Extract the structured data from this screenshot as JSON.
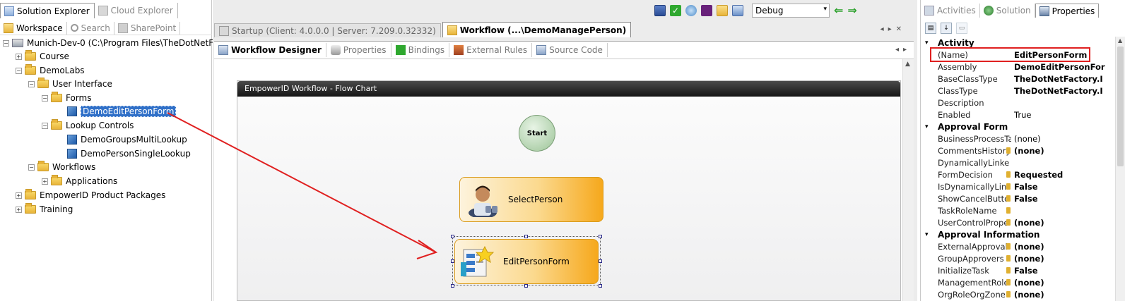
{
  "left_panel": {
    "tabs": [
      {
        "label": "Solution Explorer",
        "active": true
      },
      {
        "label": "Cloud Explorer",
        "active": false
      }
    ],
    "subtabs": [
      {
        "label": "Workspace"
      },
      {
        "label": "Search"
      },
      {
        "label": "SharePoint"
      }
    ],
    "tree": {
      "root": "Munich-Dev-0 (C:\\Program Files\\TheDotNetFacto",
      "course": "Course",
      "demolabs": "DemoLabs",
      "user_interface": "User Interface",
      "forms": "Forms",
      "demo_edit_person_form": "DemoEditPersonForm",
      "lookup_controls": "Lookup Controls",
      "demo_groups_multi_lookup": "DemoGroupsMultiLookup",
      "demo_person_single_lookup": "DemoPersonSingleLookup",
      "workflows": "Workflows",
      "applications": "Applications",
      "empowerid_product_packages": "EmpowerID Product Packages",
      "training": "Training"
    }
  },
  "toolbar": {
    "config_value": "Debug"
  },
  "document_tabs": [
    {
      "label": "Startup (Client: 4.0.0.0 | Server: 7.209.0.32332)",
      "active": false
    },
    {
      "label": "Workflow (...\\DemoManagePerson)",
      "active": true
    }
  ],
  "designer_tabs": [
    {
      "label": "Workflow Designer",
      "active": true
    },
    {
      "label": "Properties",
      "active": false
    },
    {
      "label": "Bindings",
      "active": false
    },
    {
      "label": "External Rules",
      "active": false
    },
    {
      "label": "Source Code",
      "active": false
    }
  ],
  "flowchart": {
    "title": "EmpowerID Workflow - Flow Chart",
    "start_label": "Start",
    "activities": [
      {
        "label": "SelectPerson"
      },
      {
        "label": "EditPersonForm"
      }
    ]
  },
  "right_panel": {
    "tabs": [
      {
        "label": "Activities",
        "active": false
      },
      {
        "label": "Solution",
        "active": false
      },
      {
        "label": "Properties",
        "active": true
      }
    ],
    "categories": {
      "activity": "Activity",
      "approval_form": "Approval Form",
      "approval_information": "Approval Information"
    },
    "properties": {
      "name": {
        "name": "(Name)",
        "value": "EditPersonForm"
      },
      "assembly": {
        "name": "Assembly",
        "value": "DemoEditPersonFor"
      },
      "base_class_type": {
        "name": "BaseClassType",
        "value": "TheDotNetFactory.I"
      },
      "class_type": {
        "name": "ClassType",
        "value": "TheDotNetFactory.I"
      },
      "description": {
        "name": "Description",
        "value": ""
      },
      "enabled": {
        "name": "Enabled",
        "value": "True"
      },
      "business_process": {
        "name": "BusinessProcessTa",
        "value": "(none)"
      },
      "comments_history": {
        "name": "CommentsHistory",
        "value": "(none)"
      },
      "dynamically_linked": {
        "name": "DynamicallyLinke",
        "value": ""
      },
      "form_decision": {
        "name": "FormDecision",
        "value": "Requested"
      },
      "is_dynamically_linked": {
        "name": "IsDynamicallyLin",
        "value": "False"
      },
      "show_cancel_button": {
        "name": "ShowCancelButto",
        "value": "False"
      },
      "task_role_name": {
        "name": "TaskRoleName",
        "value": ""
      },
      "user_control_properties": {
        "name": "UserControlPrope",
        "value": "(none)"
      },
      "external_approval": {
        "name": "ExternalApproval",
        "value": "(none)"
      },
      "group_approvers": {
        "name": "GroupApprovers",
        "value": "(none)"
      },
      "initialize_task": {
        "name": "InitializeTask",
        "value": "False"
      },
      "management_role": {
        "name": "ManagementRole",
        "value": "(none)"
      },
      "org_role_org_zone": {
        "name": "OrgRoleOrgZone",
        "value": "(none)"
      }
    }
  },
  "colors": {
    "selection": "#3070c8",
    "annotation_red": "#e02020",
    "activity_orange": "#f6a81c"
  }
}
